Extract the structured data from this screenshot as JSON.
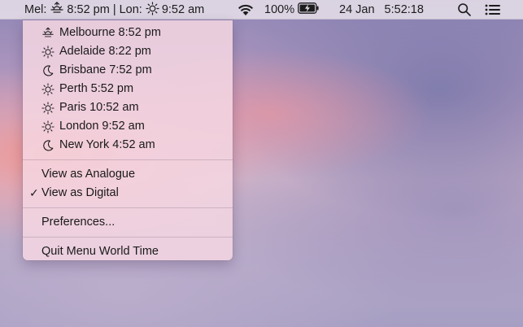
{
  "menubar": {
    "world_time": {
      "city1": "Mel:",
      "city1_icon": "sunrise-icon",
      "city1_time": "8:52 pm",
      "divider": "|",
      "city2": "Lon:",
      "city2_icon": "sun-icon",
      "city2_time": "9:52 am"
    },
    "wifi_icon": "wifi-icon",
    "battery_percent": "100%",
    "battery_icon": "battery-charging-icon",
    "date": "24 Jan",
    "time": "5:52:18",
    "search_icon": "search-icon",
    "notification_icon": "list-icon"
  },
  "menu": {
    "cities": [
      {
        "label": "Melbourne 8:52 pm",
        "icon": "sunrise-icon"
      },
      {
        "label": "Adelaide 8:22 pm",
        "icon": "sun-icon"
      },
      {
        "label": "Brisbane 7:52 pm",
        "icon": "moon-icon"
      },
      {
        "label": "Perth 5:52 pm",
        "icon": "sun-icon"
      },
      {
        "label": "Paris 10:52 am",
        "icon": "sun-icon"
      },
      {
        "label": "London 9:52 am",
        "icon": "sun-icon"
      },
      {
        "label": "New York 4:52 am",
        "icon": "moon-icon"
      }
    ],
    "view_analogue": "View as Analogue",
    "view_digital": "View as Digital",
    "view_digital_checked": "✓",
    "preferences": "Preferences...",
    "quit": "Quit Menu World Time"
  },
  "colors": {
    "menu_bg": "#f4d6e2",
    "menubar_bg": "#ece4ec",
    "text": "#1a1a1a"
  }
}
